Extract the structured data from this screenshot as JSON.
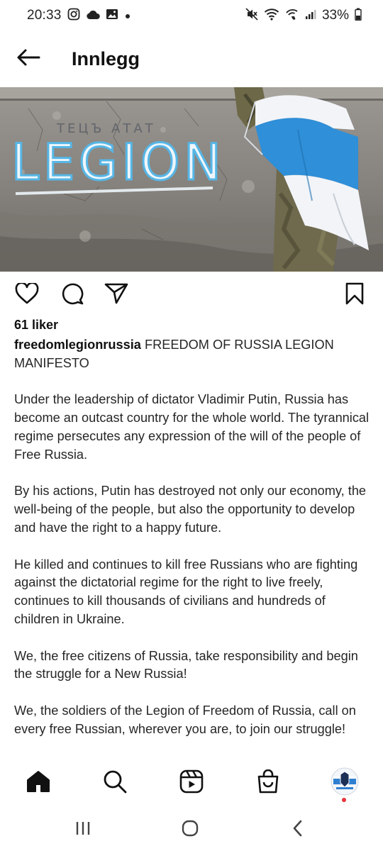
{
  "status_bar": {
    "time": "20:33",
    "battery": "33%",
    "left_icons": [
      "instagram-icon",
      "cloud-icon",
      "image-icon",
      "dot-icon"
    ],
    "right_icons": [
      "mute-icon",
      "wifi-icon",
      "wifi-call-icon",
      "signal-icon",
      "battery-icon"
    ]
  },
  "header": {
    "title": "Innlegg",
    "back_icon": "arrow-left-icon"
  },
  "post": {
    "image_text": "LEGION",
    "likes": "61 liker",
    "username": "freedomlegionrussia",
    "caption_title": "FREEDOM OF RUSSIA LEGION MANIFESTO",
    "paragraphs": [
      "Under the leadership of dictator Vladimir Putin, Russia has become an outcast country for the whole world. The tyrannical regime persecutes any expression of the will of the people of Free Russia.",
      "By his actions, Putin has destroyed not only our economy, the well-being of the people, but also the opportunity to develop and have the right to a happy future.",
      "He killed and continues to kill free Russians who are fighting against the dictatorial regime for the right to live freely, continues to kill thousands of civilians and hundreds of children in Ukraine.",
      "We, the free citizens of Russia, take responsibility and begin the struggle for a New Russia!",
      "We, the soldiers of the Legion of Freedom of Russia, call on every free Russian, wherever you are, to join our struggle!"
    ]
  },
  "actions": [
    "heart-icon",
    "comment-icon",
    "send-icon",
    "bookmark-icon"
  ],
  "bottom_nav": [
    "home-icon",
    "search-icon",
    "reels-icon",
    "shop-icon",
    "profile-avatar"
  ],
  "system_nav": [
    "recents-icon",
    "home-circle-icon",
    "back-chevron-icon"
  ],
  "colors": {
    "flag_white": "#f2f4f8",
    "flag_blue": "#2f8fd8",
    "graffiti_blue": "#56b6e6",
    "wall": "#8f8b86",
    "notification_red": "#e8323c"
  }
}
